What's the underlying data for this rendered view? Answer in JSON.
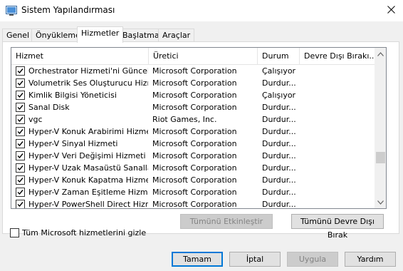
{
  "window": {
    "title": "Sistem Yapılandırması"
  },
  "tabs": [
    {
      "label": "Genel"
    },
    {
      "label": "Önyükleme"
    },
    {
      "label": "Hizmetler"
    },
    {
      "label": "Başlatma"
    },
    {
      "label": "Araçlar"
    }
  ],
  "active_tab": "Hizmetler",
  "table": {
    "columns": [
      "Hizmet",
      "Üretici",
      "Durum",
      "Devre Dışı Bırakı..."
    ],
    "rows": [
      {
        "checked": true,
        "name": "Orchestrator Hizmeti'ni Güncelleştir",
        "maker": "Microsoft Corporation",
        "status": "Çalışıyor"
      },
      {
        "checked": true,
        "name": "Volumetrik Ses Oluşturucu Hizmeti",
        "maker": "Microsoft Corporation",
        "status": "Durdur..."
      },
      {
        "checked": true,
        "name": "Kimlik Bilgisi Yöneticisi",
        "maker": "Microsoft Corporation",
        "status": "Çalışıyor"
      },
      {
        "checked": true,
        "name": "Sanal Disk",
        "maker": "Microsoft Corporation",
        "status": "Durdur..."
      },
      {
        "checked": true,
        "name": "vgc",
        "maker": "Riot Games, Inc.",
        "status": "Durdur..."
      },
      {
        "checked": true,
        "name": "Hyper-V Konuk Arabirimi Hizmeti",
        "maker": "Microsoft Corporation",
        "status": "Durdur..."
      },
      {
        "checked": true,
        "name": "Hyper-V Sinyal Hizmeti",
        "maker": "Microsoft Corporation",
        "status": "Durdur..."
      },
      {
        "checked": true,
        "name": "Hyper-V Veri Değişimi Hizmeti",
        "maker": "Microsoft Corporation",
        "status": "Durdur..."
      },
      {
        "checked": true,
        "name": "Hyper-V Uzak Masaüstü Sanallaş...",
        "maker": "Microsoft Corporation",
        "status": "Durdur..."
      },
      {
        "checked": true,
        "name": "Hyper-V Konuk Kapatma Hizmeti",
        "maker": "Microsoft Corporation",
        "status": "Durdur..."
      },
      {
        "checked": true,
        "name": "Hyper-V Zaman Eşitleme Hizmeti",
        "maker": "Microsoft Corporation",
        "status": "Durdur..."
      },
      {
        "checked": true,
        "name": "Hyper-V PowerShell Direct Hizmeti",
        "maker": "Microsoft Corporation",
        "status": "Durdur..."
      }
    ]
  },
  "buttons": {
    "enable_all": "Tümünü Etkinleştir",
    "disable_all": "Tümünü Devre Dışı Bırak",
    "ok": "Tamam",
    "cancel": "İptal",
    "apply": "Uygula",
    "help": "Yardım"
  },
  "hide_ms_label": "Tüm Microsoft hizmetlerini gizle",
  "hide_ms_checked": false,
  "icons": {
    "app": "system-config-icon",
    "close": "close-icon",
    "scroll_up": "chevron-up-icon",
    "scroll_down": "chevron-down-icon",
    "check": "check-icon"
  }
}
